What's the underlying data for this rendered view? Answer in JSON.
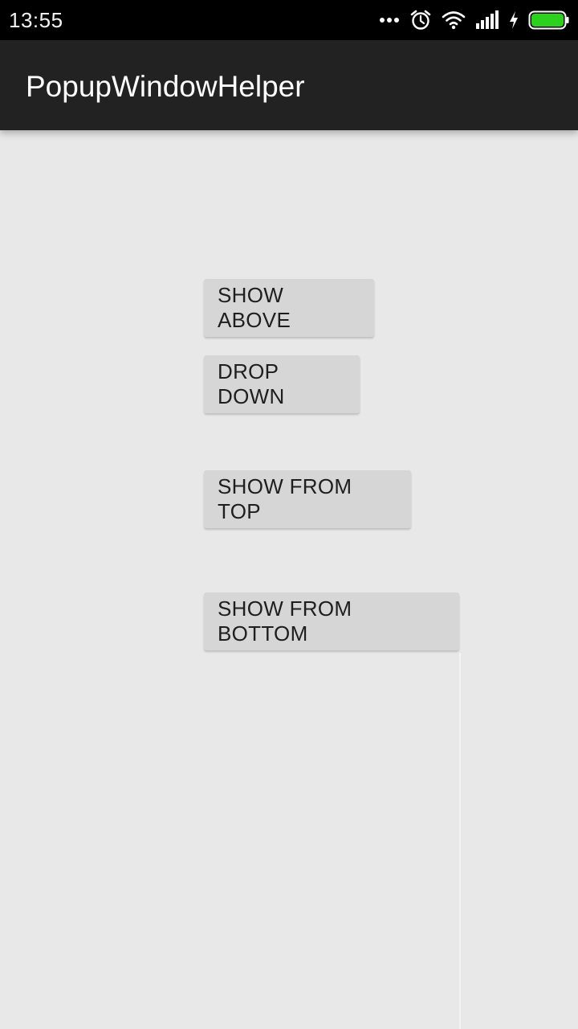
{
  "status_bar": {
    "time": "13:55",
    "icons": [
      "more-dots-icon",
      "alarm-clock-icon",
      "wifi-icon",
      "signal-icon",
      "charging-bolt-icon",
      "battery-icon"
    ],
    "battery_color": "#2bd11c"
  },
  "action_bar": {
    "title": "PopupWindowHelper"
  },
  "buttons": {
    "show_above": "SHOW ABOVE",
    "drop_down": "DROP DOWN",
    "show_from_top": "SHOW FROM TOP",
    "show_from_bottom": "SHOW FROM BOTTOM"
  },
  "colors": {
    "status_bar_bg": "#000000",
    "action_bar_bg": "#222222",
    "content_bg": "#e8e8e8",
    "button_bg": "#d6d6d6"
  }
}
